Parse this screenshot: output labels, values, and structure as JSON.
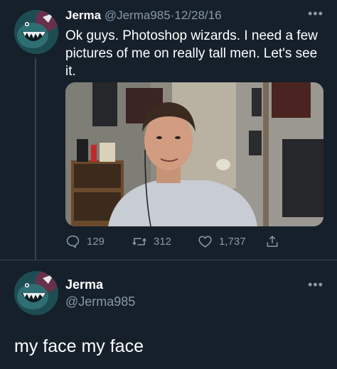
{
  "tweet": {
    "display_name": "Jerma",
    "handle": "@Jerma985",
    "separator": "·",
    "date": "12/28/16",
    "text": "Ok guys. Photoshop wizards. I need a few pictures of me on really tall men. Let's see it.",
    "actions": {
      "replies": "129",
      "retweets": "312",
      "likes": "1,737"
    },
    "icons": [
      "reply-icon",
      "retweet-icon",
      "like-icon",
      "share-icon",
      "more-icon"
    ]
  },
  "reply": {
    "display_name": "Jerma",
    "handle": "@Jerma985",
    "text": "my face my face"
  },
  "colors": {
    "background": "#15202b",
    "muted": "#8899a6",
    "divider": "#38444d"
  }
}
